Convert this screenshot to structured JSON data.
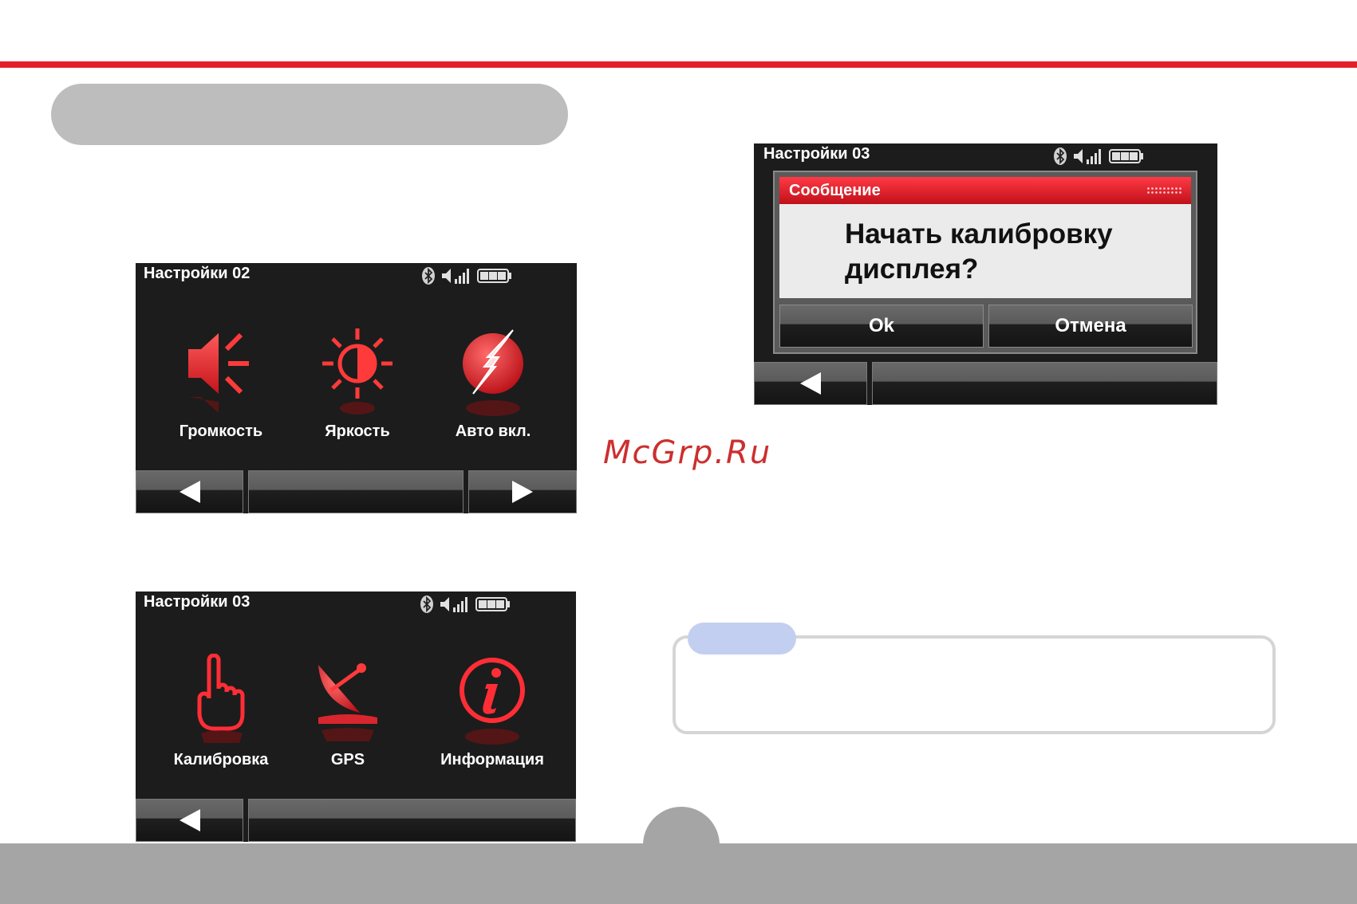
{
  "watermark": "McGrp.Ru",
  "screens": {
    "settings02": {
      "title": "Настройки 02",
      "items": [
        {
          "label": "Громкость",
          "icon": "speaker-volume-icon"
        },
        {
          "label": "Яркость",
          "icon": "sun-brightness-icon"
        },
        {
          "label": "Авто вкл.",
          "icon": "lightning-bolt-icon"
        }
      ]
    },
    "settings03": {
      "title": "Настройки 03",
      "items": [
        {
          "label": "Калибровка",
          "icon": "hand-pointer-icon"
        },
        {
          "label": "GPS",
          "icon": "satellite-dish-icon"
        },
        {
          "label": "Информация",
          "icon": "info-icon"
        }
      ]
    },
    "calibration_dialog": {
      "title": "Настройки 03",
      "header": "Сообщение",
      "message_line1": "Начать калибровку",
      "message_line2": "дисплея?",
      "ok_label": "Ok",
      "cancel_label": "Отмена"
    }
  },
  "colors": {
    "accent_red": "#e3202a",
    "screen_bg": "#1c1c1c",
    "footer_gray": "#a5a5a5",
    "note_tab": "#c3cff0"
  }
}
